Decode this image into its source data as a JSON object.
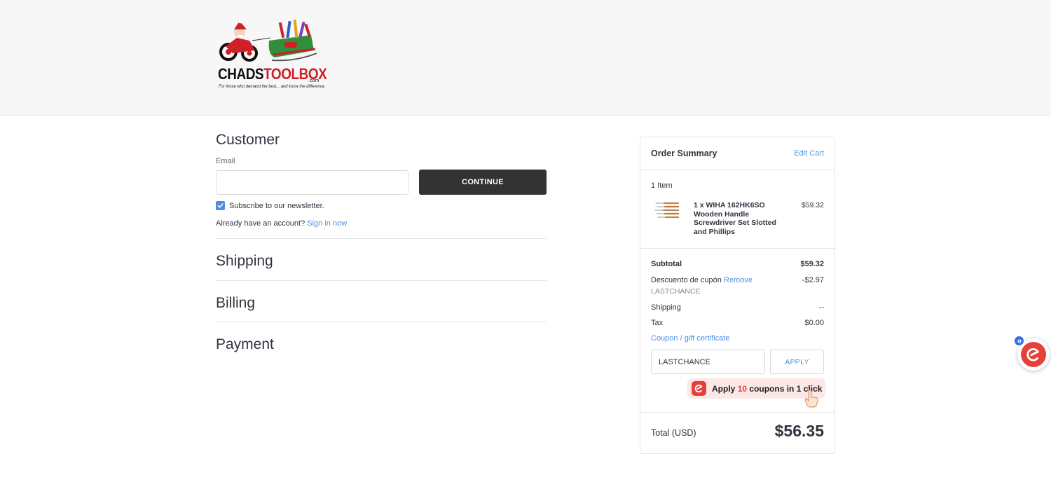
{
  "header": {
    "logo": {
      "brand_prefix": "CHADS",
      "brand_suffix": "TOOLBOX",
      "domain": ".com",
      "tagline": "For those who demand the best... and know the difference."
    }
  },
  "checkout": {
    "customer": {
      "title": "Customer",
      "email_label": "Email",
      "email_value": "",
      "continue_label": "CONTINUE",
      "newsletter_label": "Subscribe to our newsletter.",
      "newsletter_checked": true,
      "account_prompt": "Already have an account?",
      "sign_in_label": "Sign in now"
    },
    "shipping_title": "Shipping",
    "billing_title": "Billing",
    "payment_title": "Payment"
  },
  "summary": {
    "title": "Order Summary",
    "edit_cart_label": "Edit Cart",
    "item_count": "1 Item",
    "product": {
      "name": "1 x WIHA 162HK6SO Wooden Handle Screwdriver Set Slotted and Phillips",
      "price": "$59.32"
    },
    "subtotal_label": "Subtotal",
    "subtotal_value": "$59.32",
    "discount_label": "Descuento de cupón",
    "discount_remove_label": "Remove",
    "discount_code": "LASTCHANCE",
    "discount_value": "-$2.97",
    "shipping_label": "Shipping",
    "shipping_value": "--",
    "tax_label": "Tax",
    "tax_value": "$0.00",
    "coupon_toggle_label": "Coupon / gift certificate",
    "coupon_input_value": "LASTCHANCE",
    "apply_label": "APPLY",
    "coupon_pill": {
      "prefix": "Apply",
      "count": "10",
      "suffix": "coupons in 1 click"
    },
    "total_label": "Total (USD)",
    "total_value": "$56.35"
  },
  "colors": {
    "accent_link": "#4a90e2",
    "button_dark": "#333333",
    "coupon_brand_red": "#e7403a",
    "badge_blue": "#2f6fe6"
  },
  "icons": {
    "checkbox": "checkmark-icon",
    "pill_logo": "coupon-extension-logo-icon",
    "hand": "pointing-hand-icon",
    "float": "coupon-extension-float-icon"
  }
}
